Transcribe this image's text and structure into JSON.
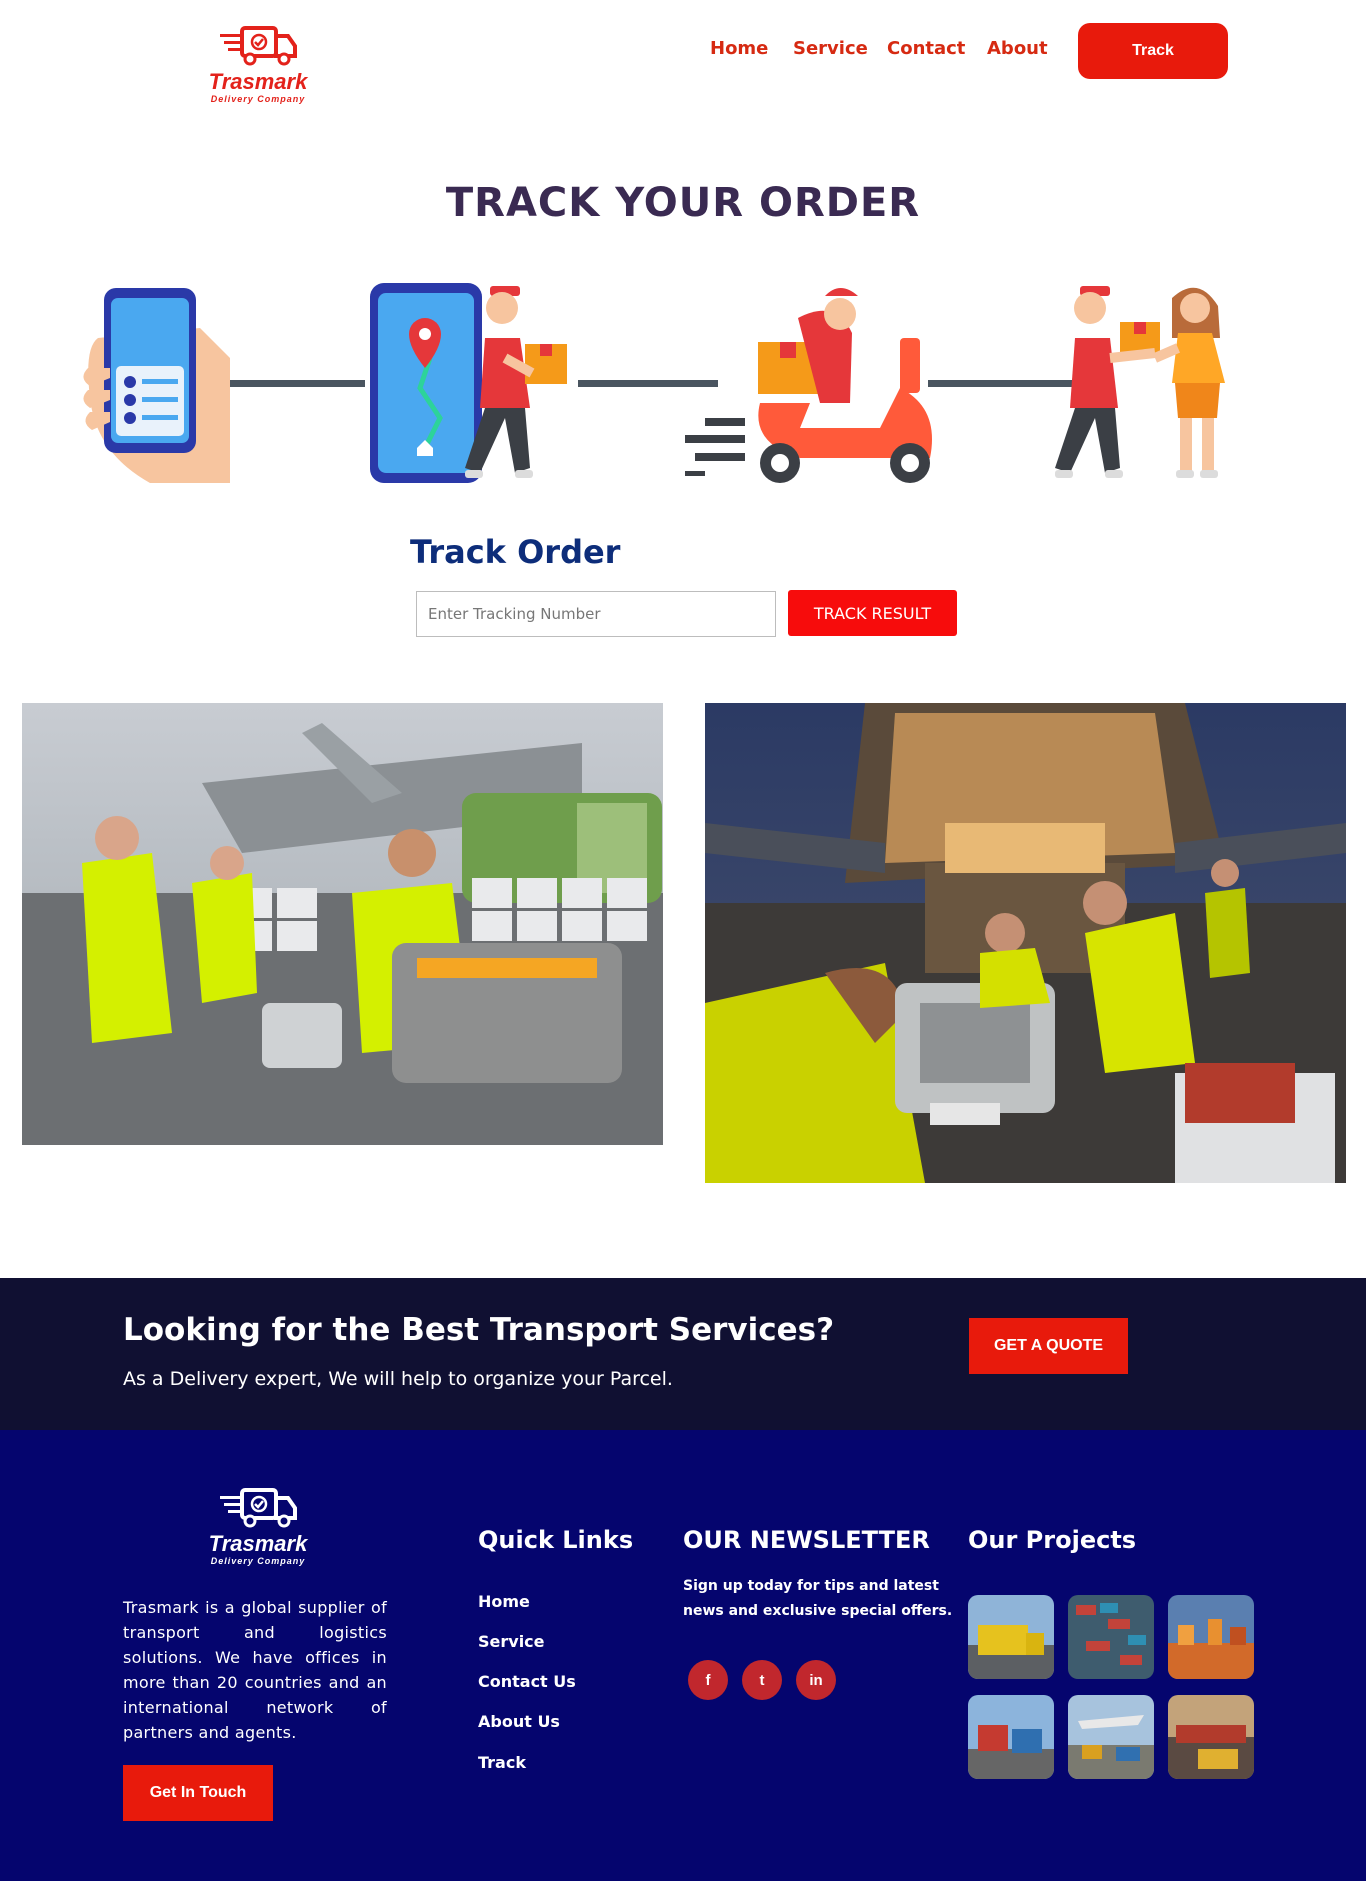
{
  "header": {
    "brand": "Trasmark",
    "tagline": "Delivery Company",
    "nav": [
      "Home",
      "Service",
      "Contact",
      "About"
    ],
    "track_button": "Track"
  },
  "main": {
    "title": "TRACK YOUR ORDER",
    "track_heading": "Track Order",
    "input_placeholder": "Enter Tracking Number",
    "result_button": "TRACK RESULT"
  },
  "cta": {
    "title": "Looking for the Best Transport Services?",
    "subtitle": "As a Delivery expert, We will help to organize your Parcel.",
    "button": "GET A QUOTE"
  },
  "footer": {
    "brand": "Trasmark",
    "tagline": "Delivery Company",
    "about": "Trasmark is a global supplier of transport and logistics solutions. We have offices in more than 20 countries and an international network of partners and agents.",
    "touch_button": "Get In Touch",
    "quick_links_title": "Quick Links",
    "quick_links": [
      "Home",
      "Service",
      "Contact Us",
      "About Us",
      "Track"
    ],
    "newsletter_title": "OUR NEWSLETTER",
    "newsletter_text": "Sign up today for tips and latest news and exclusive special offers.",
    "social": [
      {
        "icon": "facebook-icon",
        "glyph": "f"
      },
      {
        "icon": "twitter-icon",
        "glyph": "t"
      },
      {
        "icon": "linkedin-icon",
        "glyph": "in"
      }
    ],
    "projects_title": "Our Projects"
  },
  "colors": {
    "accent_red": "#e81a0c",
    "nav_red": "#d62a12",
    "title_purple": "#3a2a52",
    "track_blue": "#0d2d7a",
    "cta_bg": "#101032",
    "footer_bg": "#05056e"
  }
}
